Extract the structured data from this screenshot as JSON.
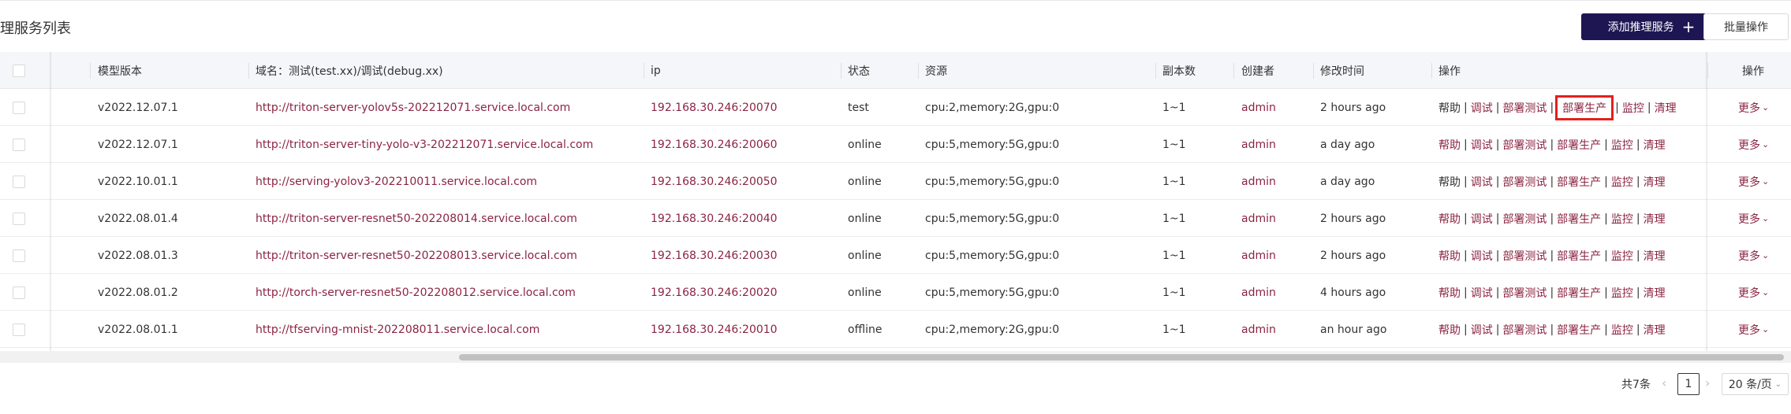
{
  "page": {
    "title": "理服务列表",
    "add_button_label": "添加推理服务",
    "add_button_icon": "plus-icon",
    "batch_button_label": "批量操作"
  },
  "table": {
    "headers": {
      "model_version": "模型版本",
      "domain": "域名：测试(test.xx)/调试(debug.xx)",
      "ip": "ip",
      "status": "状态",
      "resource": "资源",
      "replicas": "副本数",
      "creator": "创建者",
      "modified": "修改时间",
      "ops": "操作",
      "ops2": "操作"
    },
    "rows": [
      {
        "version": "v2022.12.07.1",
        "domain": "http://triton-server-yolov5s-202212071.service.local.com",
        "ip": "192.168.30.246:20070",
        "status": "test",
        "resource": "cpu:2,memory:2G,gpu:0",
        "replicas": "1~1",
        "creator": "admin",
        "modified": "2 hours ago"
      },
      {
        "version": "v2022.12.07.1",
        "domain": "http://triton-server-tiny-yolo-v3-202212071.service.local.com",
        "ip": "192.168.30.246:20060",
        "status": "online",
        "resource": "cpu:5,memory:5G,gpu:0",
        "replicas": "1~1",
        "creator": "admin",
        "modified": "a day ago"
      },
      {
        "version": "v2022.10.01.1",
        "domain": "http://serving-yolov3-202210011.service.local.com",
        "ip": "192.168.30.246:20050",
        "status": "online",
        "resource": "cpu:5,memory:5G,gpu:0",
        "replicas": "1~1",
        "creator": "admin",
        "modified": "a day ago"
      },
      {
        "version": "v2022.08.01.4",
        "domain": "http://triton-server-resnet50-202208014.service.local.com",
        "ip": "192.168.30.246:20040",
        "status": "online",
        "resource": "cpu:5,memory:5G,gpu:0",
        "replicas": "1~1",
        "creator": "admin",
        "modified": "2 hours ago"
      },
      {
        "version": "v2022.08.01.3",
        "domain": "http://triton-server-resnet50-202208013.service.local.com",
        "ip": "192.168.30.246:20030",
        "status": "online",
        "resource": "cpu:5,memory:5G,gpu:0",
        "replicas": "1~1",
        "creator": "admin",
        "modified": "2 hours ago"
      },
      {
        "version": "v2022.08.01.2",
        "domain": "http://torch-server-resnet50-202208012.service.local.com",
        "ip": "192.168.30.246:20020",
        "status": "online",
        "resource": "cpu:5,memory:5G,gpu:0",
        "replicas": "1~1",
        "creator": "admin",
        "modified": "4 hours ago"
      },
      {
        "version": "v2022.08.01.1",
        "domain": "http://tfserving-mnist-202208011.service.local.com",
        "ip": "192.168.30.246:20010",
        "status": "offline",
        "resource": "cpu:2,memory:2G,gpu:0",
        "replicas": "1~1",
        "creator": "admin",
        "modified": "an hour ago"
      }
    ],
    "actions": {
      "help": "帮助",
      "debug": "调试",
      "deploy_test": "部署测试",
      "deploy_prod": "部署生产",
      "monitor": "监控",
      "clean": "清理",
      "separator": "|",
      "more": "更多"
    }
  },
  "pagination": {
    "total": "共7条",
    "current_page": "1",
    "page_size": "20 条/页"
  },
  "colors": {
    "primary_button": "#1e1653",
    "link": "#8b2442",
    "highlight_box": "#e3201b",
    "header_bg": "#f5f6f9"
  }
}
